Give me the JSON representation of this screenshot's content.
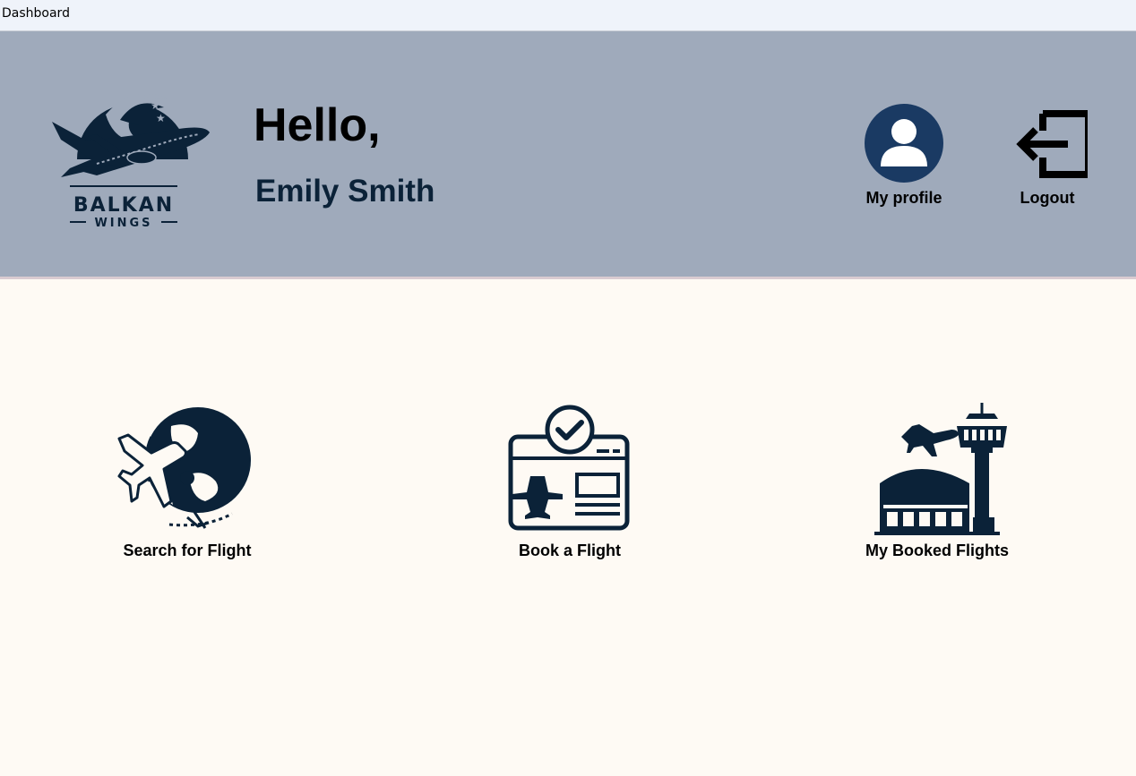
{
  "window": {
    "title": "Dashboard"
  },
  "colors": {
    "header_bg": "#9faabb",
    "page_bg": "#fefaf4",
    "navy": "#0b2238",
    "profile_circle": "#1a3a63"
  },
  "header": {
    "logo": {
      "icon": "balkan-wings-logo",
      "brand_line1": "BALKAN",
      "brand_line2": "WINGS"
    },
    "greeting": "Hello,",
    "user_name": "Emily Smith",
    "profile": {
      "label": "My profile",
      "icon": "user-avatar-icon"
    },
    "logout": {
      "label": "Logout",
      "icon": "logout-icon"
    }
  },
  "tiles": [
    {
      "label": "Search for Flight",
      "icon": "globe-plane-icon"
    },
    {
      "label": "Book a Flight",
      "icon": "boarding-pass-check-icon"
    },
    {
      "label": "My Booked Flights",
      "icon": "airport-tower-icon"
    }
  ]
}
